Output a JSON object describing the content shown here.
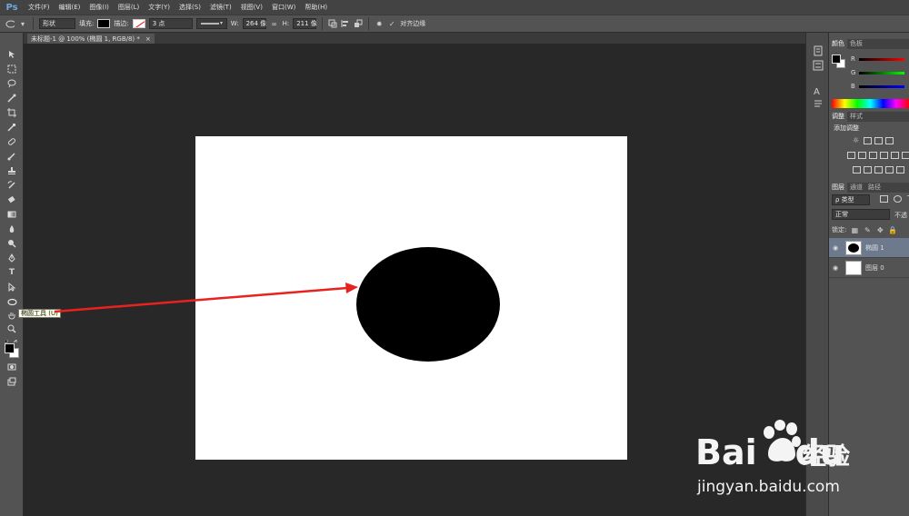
{
  "app": {
    "logo": "Ps"
  },
  "menu": [
    "文件(F)",
    "编辑(E)",
    "图像(I)",
    "图层(L)",
    "文字(Y)",
    "选择(S)",
    "滤镜(T)",
    "视图(V)",
    "窗口(W)",
    "帮助(H)"
  ],
  "options": {
    "mode": "形状",
    "fill_label": "填充:",
    "stroke_label": "描边:",
    "stroke_width": "3 点",
    "w_label": "W:",
    "w_value": "264 像",
    "link_icon": "link-icon",
    "h_label": "H:",
    "h_value": "211 像",
    "align_edges": "对齐边缘"
  },
  "document": {
    "tab_title": "未标题-1 @ 100% (椭圆 1, RGB/8) *",
    "close": "×"
  },
  "tooltip": "椭圆工具 (U)",
  "colors": {
    "fill": "#000000",
    "canvas": "#ffffff",
    "arrow": "#e8231e",
    "workspace": "#282828"
  },
  "panels": {
    "color_tabs": [
      "颜色",
      "色板"
    ],
    "rgb": [
      "R",
      "G",
      "B"
    ],
    "adjust_tabs": [
      "调整",
      "样式"
    ],
    "adjust_title": "添加调整",
    "layer_tabs": [
      "图层",
      "通道",
      "路径"
    ],
    "kind": "ρ 类型",
    "blend": "正常",
    "opacity_label": "不透",
    "lock_label": "锁定:",
    "layers": [
      {
        "name": "椭圆 1",
        "selected": true
      },
      {
        "name": "图层 0",
        "selected": false
      }
    ]
  },
  "watermark": {
    "brand_bai": "Bai",
    "brand_du": "du",
    "brand_cn": "经验",
    "url": "jingyan.baidu.com"
  }
}
